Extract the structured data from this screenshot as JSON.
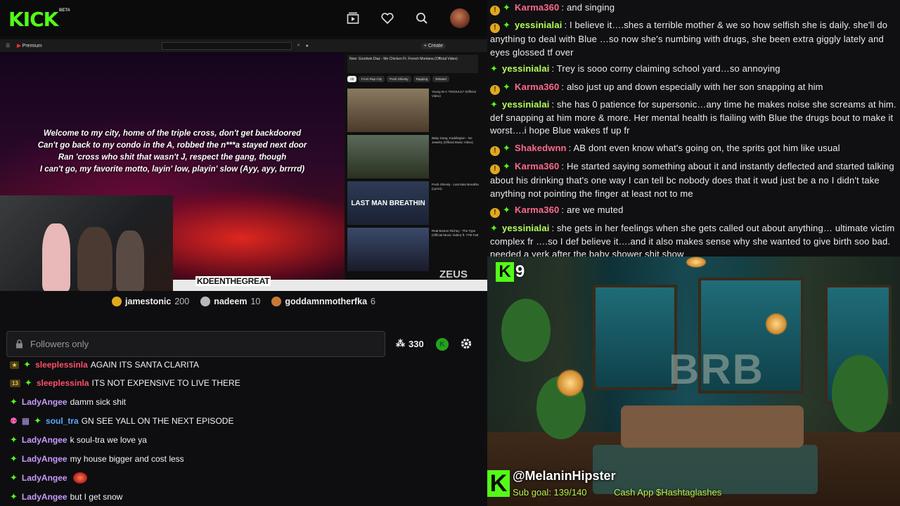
{
  "app": {
    "logo": "KICK",
    "beta": "BETA"
  },
  "colors": {
    "accent": "#53fc18",
    "gold": "#e0a81e"
  },
  "icons": [
    "clip-icon",
    "heart-icon",
    "search-icon",
    "user-avatar"
  ],
  "video": {
    "lyrics": [
      "Welcome to my city, home of the triple cross, don't get backdoored",
      "Can't go back to my condo in the A, robbed the n***a stayed next door",
      "Ran 'cross who shit that wasn't J, respect the gang, though",
      "I can't go, my favorite motto, layin' low, playin' slow (Ayy, ayy, brrrrd)"
    ],
    "yt_logo": "Premium",
    "yt_create": "+ Create",
    "yt_side_title": "Now: Goodwin Diaz - Mo Chicken Ft. French Montana (Official Video)",
    "chips": [
      "All",
      "From Rap City",
      "Pooh Shiesty",
      "Rapping",
      "Related",
      "For you"
    ],
    "side_items": [
      "Young M.A \"OOOUUU\" (Official Video)",
      "Baby Gang, Kaddington - No Jewelry (Official Music Video)",
      "Pooh Shiesty - Last Man Breathin (Lyrics)",
      "Real Boston Richey - The Type (Official Music Video) ft. YTB Fatt"
    ],
    "lmb_label": "LAST MAN BREATHIN",
    "zeus": "ZEUS",
    "overlay_tag": "KDEENTHEGREAT"
  },
  "leaderboard": [
    {
      "name": "jamestonic",
      "score": "200",
      "color": "#e0a81e"
    },
    {
      "name": "nadeem",
      "score": "10",
      "color": "#b8b8b8"
    },
    {
      "name": "goddamnmotherfka",
      "score": "6",
      "color": "#c87a35"
    }
  ],
  "chat_input": {
    "placeholder": "Followers only"
  },
  "viewers": "330",
  "left_chat": [
    {
      "user": "sleeplessinla",
      "color": "#ff4f6a",
      "text": "AGAIN ITS SANTA CLARITA",
      "badge": "sub",
      "partial": true
    },
    {
      "user": "sleeplessinla",
      "color": "#ff4f6a",
      "text": "ITS NOT EXPENSIVE TO LIVE THERE",
      "badge": "sub13"
    },
    {
      "user": "LadyAngee",
      "color": "#c79bff",
      "text": "damm sick shit"
    },
    {
      "user": "soul_tra",
      "color": "#5aa8ff",
      "text": "GN SEE YALL ON THE NEXT EPISODE",
      "badge": "multi"
    },
    {
      "user": "LadyAngee",
      "color": "#c79bff",
      "text": "k soul-tra we love ya"
    },
    {
      "user": "LadyAngee",
      "color": "#c79bff",
      "text": "my house bigger and cost less"
    },
    {
      "user": "LadyAngee",
      "color": "#c79bff",
      "text": "",
      "emote": true
    },
    {
      "user": "LadyAngee",
      "color": "#c79bff",
      "text": "but I get snow"
    }
  ],
  "right_chat": [
    {
      "user": "Karma360",
      "color": "#ff6a8b",
      "text": "and singing",
      "badges": [
        "o",
        "d"
      ]
    },
    {
      "user": "yessinialai",
      "color": "#b5ff5a",
      "text": "I believe it….shes a terrible mother & we so how selfish she is daily. she'll do anything to deal with Blue …so now she's numbing with drugs, she been extra giggly lately and eyes glossed tf over",
      "badges": [
        "o",
        "d"
      ]
    },
    {
      "user": "yessinialai",
      "color": "#b5ff5a",
      "text": "Trey is sooo corny claiming school yard…so annoying",
      "badges": [
        "d"
      ]
    },
    {
      "user": "Karma360",
      "color": "#ff6a8b",
      "text": "also just up and down especially with her son snapping at him",
      "badges": [
        "o",
        "d"
      ]
    },
    {
      "user": "yessinialai",
      "color": "#b5ff5a",
      "text": "she has 0 patience for supersonic…any time he makes noise she screams at him. def snapping at him more & more. Her mental health is flailing with Blue the drugs bout to make it worst….i hope Blue wakes tf up fr",
      "badges": [
        "d"
      ]
    },
    {
      "user": "Shakedwnn",
      "color": "#ff6a8b",
      "text": "AB dont even know what's going on, the sprits got him like usual",
      "badges": [
        "o",
        "d"
      ]
    },
    {
      "user": "Karma360",
      "color": "#ff6a8b",
      "text": "He started saying something about it and instantly deflected and started talking about his drinking that's one way I can tell bc nobody does that it wud just be a no I didn't take anything not pointing the finger at least not to me",
      "badges": [
        "o",
        "d"
      ]
    },
    {
      "user": "Karma360",
      "color": "#ff6a8b",
      "text": "are we muted",
      "badges": [
        "o",
        "d"
      ]
    },
    {
      "user": "yessinialai",
      "color": "#b5ff5a",
      "text": "she gets in her feelings when she gets called out about anything… ultimate victim complex fr ….so I def believe it….and it also makes sense why she wanted to give birth soo bad. needed a yerk after the baby shower shit show",
      "badges": [
        "d"
      ]
    }
  ],
  "brb": {
    "kick_count": "9",
    "text": "BRB",
    "handle": "@MelaninHipster",
    "sub_goal": "Sub goal: 139/140",
    "cashapp": "Cash App $Hashtaglashes"
  }
}
